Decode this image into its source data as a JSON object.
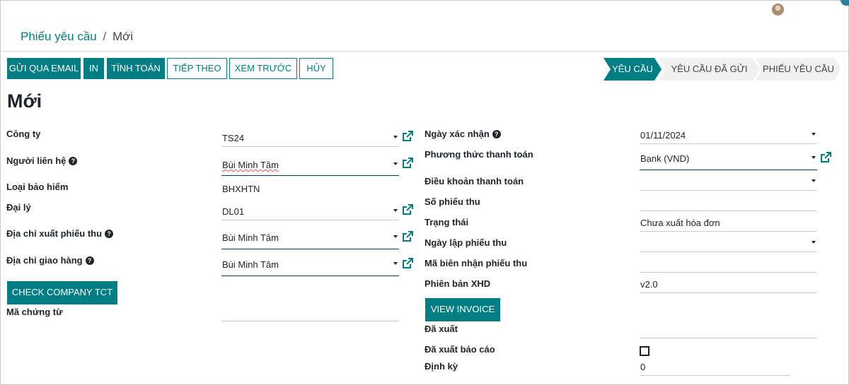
{
  "breadcrumb": {
    "parent": "Phiếu yêu cầu",
    "separator": "/",
    "current": "Mới"
  },
  "actions": {
    "send_email": "GỬI QUA EMAIL",
    "print": "IN",
    "compute": "TÍNH TOÁN",
    "next": "TIẾP THEO",
    "preview": "XEM TRƯỚC",
    "cancel": "HỦY"
  },
  "statusbar": [
    "YÊU CẦU",
    "YÊU CẦU ĐÃ GỬI",
    "PHIẾU YÊU CẦU"
  ],
  "record_title": "Mới",
  "left": {
    "company_label": "Công ty",
    "company_value": "TS24",
    "contact_label": "Người liên hệ",
    "contact_value": "Bùi Minh Tâm",
    "insurance_label": "Loại bảo hiểm",
    "insurance_value": "BHXHTN",
    "agent_label": "Đại lý",
    "agent_value": "DL01",
    "invoice_addr_label": "Địa chỉ xuất phiếu thu",
    "invoice_addr_value": "Bùi Minh Tâm",
    "delivery_addr_label": "Địa chỉ giao hàng",
    "delivery_addr_value": "Bùi Minh Tâm",
    "check_company_button": "CHECK COMPANY TCT",
    "voucher_code_label": "Mã chứng từ",
    "voucher_code_value": ""
  },
  "right": {
    "confirm_date_label": "Ngày xác nhận",
    "confirm_date_value": "01/11/2024",
    "payment_method_label": "Phương thức thanh toán",
    "payment_method_value": "Bank (VND)",
    "payment_terms_label": "Điều khoản thanh toán",
    "payment_terms_value": "",
    "receipt_no_label": "Số phiếu thu",
    "receipt_no_value": "",
    "state_label": "Trạng thái",
    "state_value": "Chưa xuất hóa đơn",
    "receipt_date_label": "Ngày lập phiếu thu",
    "receipt_date_value": "",
    "receipt_code_label": "Mã biên nhận phiếu thu",
    "receipt_code_value": "",
    "xhd_version_label": "Phiên bản XHD",
    "xhd_version_value": "v2.0",
    "view_invoice_button": "VIEW INVOICE",
    "exported_label": "Đã xuất",
    "exported_value": "",
    "report_exported_label": "Đã xuất báo cáo",
    "periodic_label": "Định kỳ",
    "periodic_value": "0"
  },
  "help_glyph": "?",
  "colors": {
    "primary": "#017e84"
  }
}
